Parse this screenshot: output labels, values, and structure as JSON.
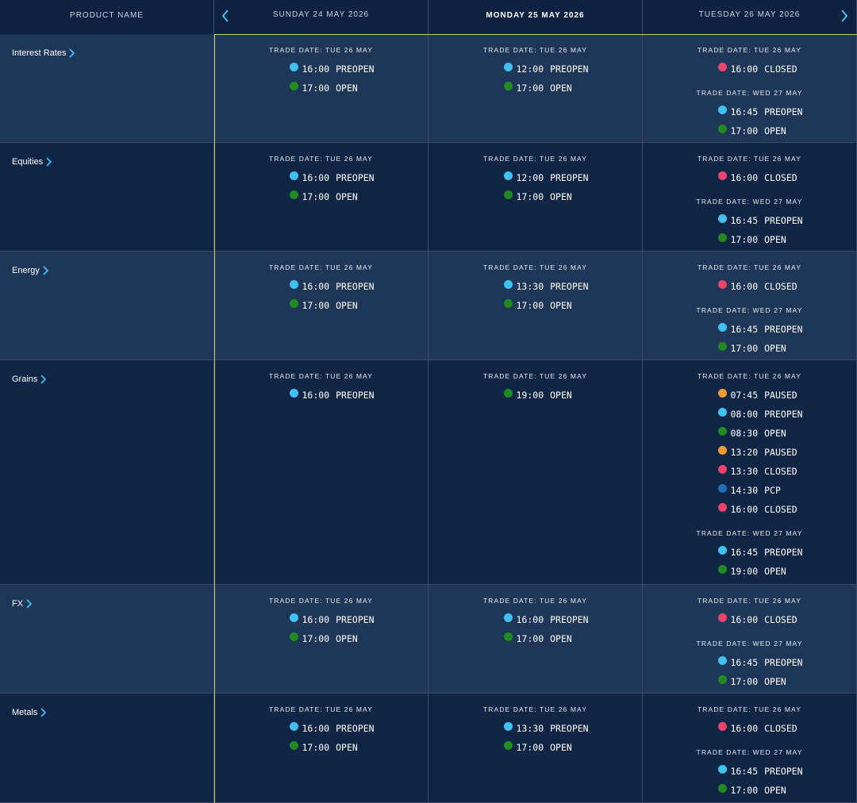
{
  "header": {
    "product_label": "PRODUCT NAME",
    "days": [
      "SUNDAY 24 MAY 2026",
      "MONDAY 25 MAY 2026",
      "TUESDAY 26 MAY 2026"
    ],
    "prev_icon": "chevron-left-icon",
    "next_icon": "chevron-right-icon"
  },
  "colors": {
    "PREOPEN": "#3fc1f2",
    "OPEN": "#238a1f",
    "CLOSED": "#f0436b",
    "PAUSED": "#f39a36",
    "PCP": "#1e6fb3",
    "accent_border": "#c8c86a",
    "row_light": "#1e3658",
    "row_dark": "#0f2545"
  },
  "rows": [
    {
      "product": "Interest Rates",
      "cells": [
        [
          {
            "trade_date": "TRADE DATE: TUE 26 MAY",
            "events": [
              {
                "time": "16:00",
                "status": "PREOPEN"
              },
              {
                "time": "17:00",
                "status": "OPEN"
              }
            ]
          }
        ],
        [
          {
            "trade_date": "TRADE DATE: TUE 26 MAY",
            "events": [
              {
                "time": "12:00",
                "status": "PREOPEN"
              },
              {
                "time": "17:00",
                "status": "OPEN"
              }
            ]
          }
        ],
        [
          {
            "trade_date": "TRADE DATE: TUE 26 MAY",
            "events": [
              {
                "time": "16:00",
                "status": "CLOSED"
              }
            ]
          },
          {
            "trade_date": "TRADE DATE: WED 27 MAY",
            "events": [
              {
                "time": "16:45",
                "status": "PREOPEN"
              },
              {
                "time": "17:00",
                "status": "OPEN"
              }
            ]
          }
        ]
      ]
    },
    {
      "product": "Equities",
      "cells": [
        [
          {
            "trade_date": "TRADE DATE: TUE 26 MAY",
            "events": [
              {
                "time": "16:00",
                "status": "PREOPEN"
              },
              {
                "time": "17:00",
                "status": "OPEN"
              }
            ]
          }
        ],
        [
          {
            "trade_date": "TRADE DATE: TUE 26 MAY",
            "events": [
              {
                "time": "12:00",
                "status": "PREOPEN"
              },
              {
                "time": "17:00",
                "status": "OPEN"
              }
            ]
          }
        ],
        [
          {
            "trade_date": "TRADE DATE: TUE 26 MAY",
            "events": [
              {
                "time": "16:00",
                "status": "CLOSED"
              }
            ]
          },
          {
            "trade_date": "TRADE DATE: WED 27 MAY",
            "events": [
              {
                "time": "16:45",
                "status": "PREOPEN"
              },
              {
                "time": "17:00",
                "status": "OPEN"
              }
            ]
          }
        ]
      ]
    },
    {
      "product": "Energy",
      "cells": [
        [
          {
            "trade_date": "TRADE DATE: TUE 26 MAY",
            "events": [
              {
                "time": "16:00",
                "status": "PREOPEN"
              },
              {
                "time": "17:00",
                "status": "OPEN"
              }
            ]
          }
        ],
        [
          {
            "trade_date": "TRADE DATE: TUE 26 MAY",
            "events": [
              {
                "time": "13:30",
                "status": "PREOPEN"
              },
              {
                "time": "17:00",
                "status": "OPEN"
              }
            ]
          }
        ],
        [
          {
            "trade_date": "TRADE DATE: TUE 26 MAY",
            "events": [
              {
                "time": "16:00",
                "status": "CLOSED"
              }
            ]
          },
          {
            "trade_date": "TRADE DATE: WED 27 MAY",
            "events": [
              {
                "time": "16:45",
                "status": "PREOPEN"
              },
              {
                "time": "17:00",
                "status": "OPEN"
              }
            ]
          }
        ]
      ]
    },
    {
      "product": "Grains",
      "cells": [
        [
          {
            "trade_date": "TRADE DATE: TUE 26 MAY",
            "events": [
              {
                "time": "16:00",
                "status": "PREOPEN"
              }
            ]
          }
        ],
        [
          {
            "trade_date": "TRADE DATE: TUE 26 MAY",
            "events": [
              {
                "time": "19:00",
                "status": "OPEN"
              }
            ]
          }
        ],
        [
          {
            "trade_date": "TRADE DATE: TUE 26 MAY",
            "events": [
              {
                "time": "07:45",
                "status": "PAUSED"
              },
              {
                "time": "08:00",
                "status": "PREOPEN"
              },
              {
                "time": "08:30",
                "status": "OPEN"
              },
              {
                "time": "13:20",
                "status": "PAUSED"
              },
              {
                "time": "13:30",
                "status": "CLOSED"
              },
              {
                "time": "14:30",
                "status": "PCP"
              },
              {
                "time": "16:00",
                "status": "CLOSED"
              }
            ]
          },
          {
            "trade_date": "TRADE DATE: WED 27 MAY",
            "events": [
              {
                "time": "16:45",
                "status": "PREOPEN"
              },
              {
                "time": "19:00",
                "status": "OPEN"
              }
            ]
          }
        ]
      ]
    },
    {
      "product": "FX",
      "cells": [
        [
          {
            "trade_date": "TRADE DATE: TUE 26 MAY",
            "events": [
              {
                "time": "16:00",
                "status": "PREOPEN"
              },
              {
                "time": "17:00",
                "status": "OPEN"
              }
            ]
          }
        ],
        [
          {
            "trade_date": "TRADE DATE: TUE 26 MAY",
            "events": [
              {
                "time": "16:00",
                "status": "PREOPEN"
              },
              {
                "time": "17:00",
                "status": "OPEN"
              }
            ]
          }
        ],
        [
          {
            "trade_date": "TRADE DATE: TUE 26 MAY",
            "events": [
              {
                "time": "16:00",
                "status": "CLOSED"
              }
            ]
          },
          {
            "trade_date": "TRADE DATE: WED 27 MAY",
            "events": [
              {
                "time": "16:45",
                "status": "PREOPEN"
              },
              {
                "time": "17:00",
                "status": "OPEN"
              }
            ]
          }
        ]
      ]
    },
    {
      "product": "Metals",
      "cells": [
        [
          {
            "trade_date": "TRADE DATE: TUE 26 MAY",
            "events": [
              {
                "time": "16:00",
                "status": "PREOPEN"
              },
              {
                "time": "17:00",
                "status": "OPEN"
              }
            ]
          }
        ],
        [
          {
            "trade_date": "TRADE DATE: TUE 26 MAY",
            "events": [
              {
                "time": "13:30",
                "status": "PREOPEN"
              },
              {
                "time": "17:00",
                "status": "OPEN"
              }
            ]
          }
        ],
        [
          {
            "trade_date": "TRADE DATE: TUE 26 MAY",
            "events": [
              {
                "time": "16:00",
                "status": "CLOSED"
              }
            ]
          },
          {
            "trade_date": "TRADE DATE: WED 27 MAY",
            "events": [
              {
                "time": "16:45",
                "status": "PREOPEN"
              },
              {
                "time": "17:00",
                "status": "OPEN"
              }
            ]
          }
        ]
      ]
    }
  ]
}
